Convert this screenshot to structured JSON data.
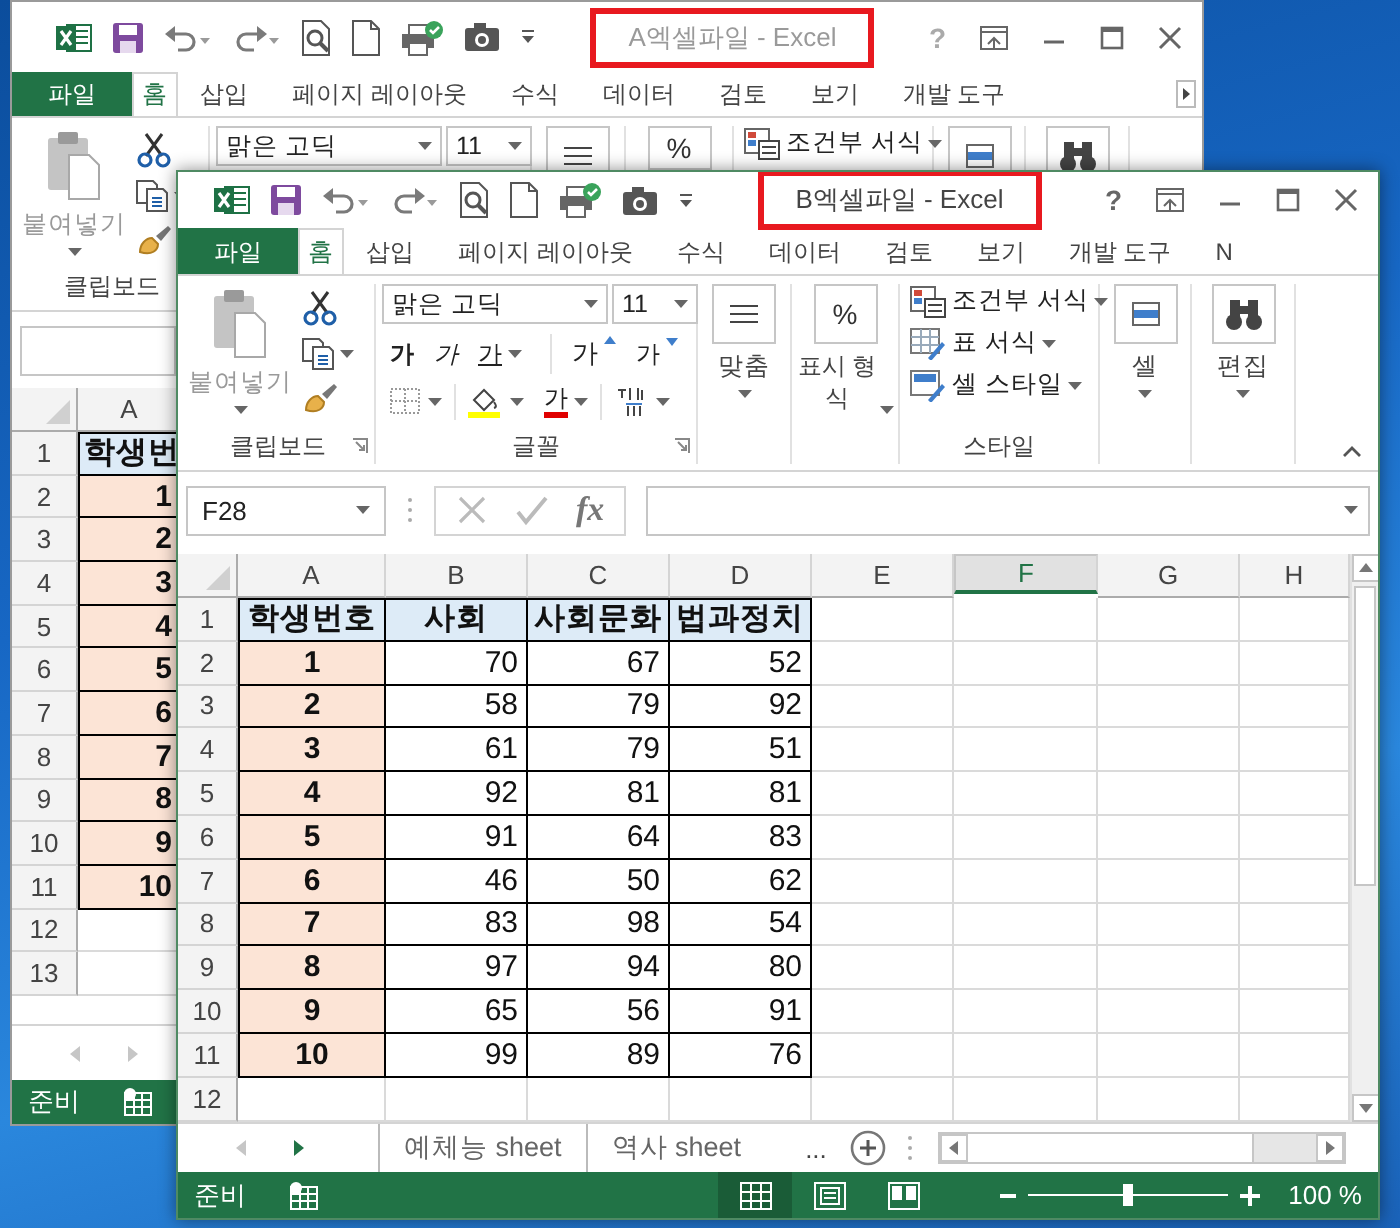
{
  "back_window": {
    "title": "A엑셀파일 - Excel",
    "title_marked": true,
    "active": false,
    "help": "?",
    "tabs_scrollable": true,
    "tabs": [
      {
        "label": "파일",
        "kind": "file",
        "selected": false
      },
      {
        "label": "홈",
        "kind": "tab",
        "selected": true
      },
      {
        "label": "삽입",
        "kind": "tab",
        "selected": false
      },
      {
        "label": "페이지 레이아웃",
        "kind": "tab",
        "selected": false
      },
      {
        "label": "수식",
        "kind": "tab",
        "selected": false
      },
      {
        "label": "데이터",
        "kind": "tab",
        "selected": false
      },
      {
        "label": "검토",
        "kind": "tab",
        "selected": false
      },
      {
        "label": "보기",
        "kind": "tab",
        "selected": false
      },
      {
        "label": "개발 도구",
        "kind": "tab",
        "selected": false
      }
    ],
    "ribbon": {
      "paste": "붙여넣기",
      "clipboard": "클립보드",
      "font": "맑은 고딕",
      "font_size": "11",
      "number_symbol": "%",
      "styles": [
        "조건부 서식"
      ]
    },
    "columns": [
      {
        "label": "A",
        "selected": false
      }
    ],
    "rows": [
      {
        "number": "1",
        "kind": "header",
        "cells": [
          "학생번"
        ]
      },
      {
        "number": "2",
        "kind": "data",
        "cells": [
          "1"
        ]
      },
      {
        "number": "3",
        "kind": "data",
        "cells": [
          "2"
        ]
      },
      {
        "number": "4",
        "kind": "data",
        "cells": [
          "3"
        ]
      },
      {
        "number": "5",
        "kind": "data",
        "cells": [
          "4"
        ]
      },
      {
        "number": "6",
        "kind": "data",
        "cells": [
          "5"
        ]
      },
      {
        "number": "7",
        "kind": "data",
        "cells": [
          "6"
        ]
      },
      {
        "number": "8",
        "kind": "data",
        "cells": [
          "7"
        ]
      },
      {
        "number": "9",
        "kind": "data",
        "cells": [
          "8"
        ]
      },
      {
        "number": "10",
        "kind": "data",
        "cells": [
          "9"
        ]
      },
      {
        "number": "11",
        "kind": "data",
        "cells": [
          "10"
        ]
      },
      {
        "number": "12",
        "kind": "empty"
      },
      {
        "number": "13",
        "kind": "empty"
      }
    ],
    "status": "준비"
  },
  "front_window": {
    "title": "B엑셀파일 - Excel",
    "title_marked": true,
    "active": true,
    "help": "?",
    "tabs": [
      {
        "label": "파일",
        "kind": "file",
        "selected": false
      },
      {
        "label": "홈",
        "kind": "tab",
        "selected": true
      },
      {
        "label": "삽입",
        "kind": "tab",
        "selected": false
      },
      {
        "label": "페이지 레이아웃",
        "kind": "tab",
        "selected": false
      },
      {
        "label": "수식",
        "kind": "tab",
        "selected": false
      },
      {
        "label": "데이터",
        "kind": "tab",
        "selected": false
      },
      {
        "label": "검토",
        "kind": "tab",
        "selected": false
      },
      {
        "label": "보기",
        "kind": "tab",
        "selected": false
      },
      {
        "label": "개발 도구",
        "kind": "tab",
        "selected": false
      },
      {
        "label": "N",
        "kind": "tab",
        "selected": false
      }
    ],
    "ribbon": {
      "paste": "붙여넣기",
      "clipboard": "클립보드",
      "font": "맑은 고딕",
      "font_size": "11",
      "font_buttons": [
        {
          "label": "가",
          "kind": "bold"
        },
        {
          "label": "가",
          "kind": "italic"
        },
        {
          "label": "가",
          "kind": "underline"
        },
        {
          "label": "가",
          "kind": "grow"
        },
        {
          "label": "가",
          "kind": "shrink"
        }
      ],
      "font_color": "가",
      "font_group": "글꼴",
      "align": "맞춤",
      "number_symbol": "%",
      "number_format": "표시 형식",
      "styles": [
        "조건부 서식",
        "표 서식",
        "셀 스타일"
      ],
      "styles_group": "스타일",
      "cells": "셀",
      "editing": "편집"
    },
    "name_box": "F28",
    "function_label": "fx",
    "columns": [
      {
        "label": "A",
        "selected": false
      },
      {
        "label": "B",
        "selected": false
      },
      {
        "label": "C",
        "selected": false
      },
      {
        "label": "D",
        "selected": false
      },
      {
        "label": "E",
        "selected": false
      },
      {
        "label": "F",
        "selected": true
      },
      {
        "label": "G",
        "selected": false
      },
      {
        "label": "H",
        "selected": false
      }
    ],
    "rows": [
      {
        "number": "1",
        "kind": "header",
        "cells": [
          "학생번호",
          "사회",
          "사회문화",
          "법과정치"
        ]
      },
      {
        "number": "2",
        "kind": "data",
        "cells": [
          "1",
          "70",
          "67",
          "52"
        ]
      },
      {
        "number": "3",
        "kind": "data",
        "cells": [
          "2",
          "58",
          "79",
          "92"
        ]
      },
      {
        "number": "4",
        "kind": "data",
        "cells": [
          "3",
          "61",
          "79",
          "51"
        ]
      },
      {
        "number": "5",
        "kind": "data",
        "cells": [
          "4",
          "92",
          "81",
          "81"
        ]
      },
      {
        "number": "6",
        "kind": "data",
        "cells": [
          "5",
          "91",
          "64",
          "83"
        ]
      },
      {
        "number": "7",
        "kind": "data",
        "cells": [
          "6",
          "46",
          "50",
          "62"
        ]
      },
      {
        "number": "8",
        "kind": "data",
        "cells": [
          "7",
          "83",
          "98",
          "54"
        ]
      },
      {
        "number": "9",
        "kind": "data",
        "cells": [
          "8",
          "97",
          "94",
          "80"
        ]
      },
      {
        "number": "10",
        "kind": "data",
        "cells": [
          "9",
          "65",
          "56",
          "91"
        ]
      },
      {
        "number": "11",
        "kind": "data",
        "cells": [
          "10",
          "99",
          "89",
          "76"
        ]
      },
      {
        "number": "12",
        "kind": "empty"
      }
    ],
    "sheet_tabs": [
      {
        "label": "예체능 sheet",
        "selected": false
      },
      {
        "label": "역사 sheet",
        "selected": false
      }
    ],
    "more_tabs": "...",
    "status": "준비",
    "views": [
      {
        "kind": "normal",
        "selected": true
      },
      {
        "kind": "page_layout",
        "selected": false
      },
      {
        "kind": "page_break",
        "selected": false
      }
    ],
    "zoom": {
      "level": 0.5,
      "reading": "100 %"
    }
  }
}
